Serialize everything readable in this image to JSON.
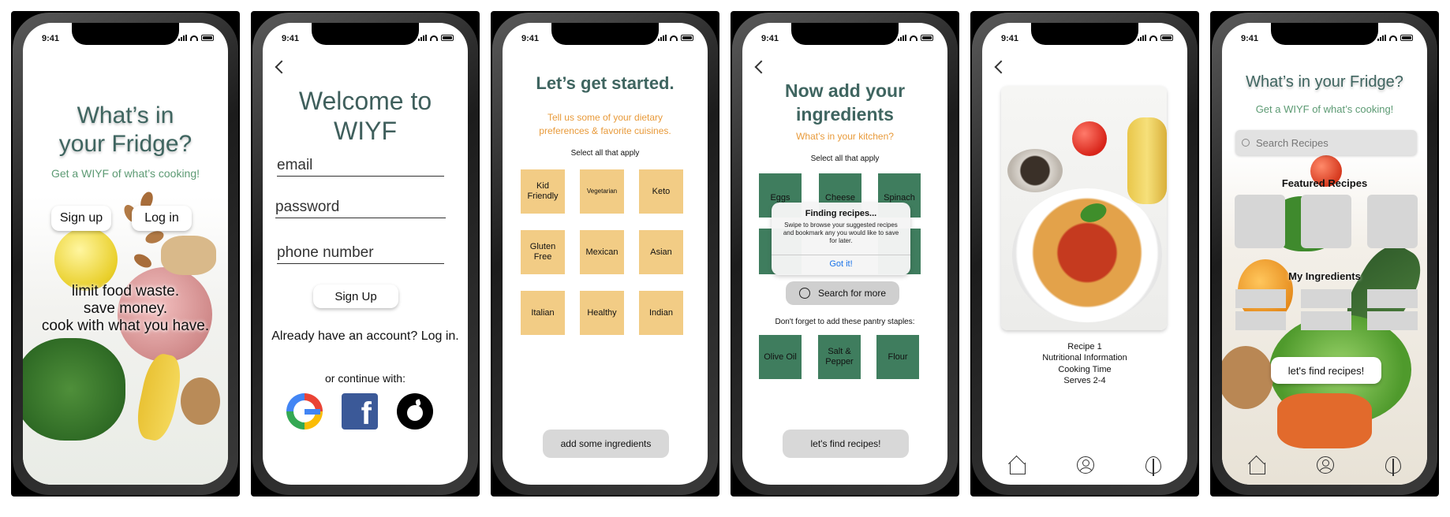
{
  "status_time": "9:41",
  "screens": {
    "landing": {
      "title_line1": "What’s in",
      "title_line2": "your Fridge?",
      "subtitle": "Get a WIYF of what’s cooking!",
      "signup_label": "Sign up",
      "login_label": "Log in",
      "tagline_1": "limit food waste.",
      "tagline_2": "save money.",
      "tagline_3": "cook with what you have."
    },
    "signup": {
      "title_line1": "Welcome to",
      "title_line2": "WIYF",
      "email_placeholder": "email",
      "password_placeholder": "password",
      "phone_placeholder": "phone number",
      "signup_button": "Sign Up",
      "login_prompt": "Already have an account? Log in.",
      "continue_with": "or continue with:",
      "social": [
        "google-icon",
        "facebook-icon",
        "apple-icon"
      ]
    },
    "preferences": {
      "title": "Let’s get started.",
      "subtitle_1": "Tell us some of your dietary",
      "subtitle_2": "preferences & favorite cuisines.",
      "instruction": "Select all that apply",
      "options": [
        "Kid Friendly",
        "Vegetarian",
        "Keto",
        "Gluten Free",
        "Mexican",
        "Asian",
        "Italian",
        "Healthy",
        "Indian"
      ],
      "next_button": "add some ingredients",
      "tile_color": "#f2cc85"
    },
    "ingredients": {
      "title_line1": "Now add your",
      "title_line2": "ingredients",
      "subtitle": "What’s in your kitchen?",
      "instruction": "Select all that apply",
      "options": [
        "Eggs",
        "Cheese",
        "Spinach"
      ],
      "dialog_title": "Finding recipes...",
      "dialog_body": "Swipe to browse your suggested recipes and bookmark any you would like to save for later.",
      "dialog_button": "Got it!",
      "search_label": "Search for more",
      "staples_label": "Don't forget to add these pantry staples:",
      "staples": [
        "Olive Oil",
        "Salt & Pepper",
        "Flour"
      ],
      "find_button": "let's find recipes!",
      "tile_color": "#3f7d5e"
    },
    "recipe": {
      "name": "Recipe 1",
      "nutrition": "Nutritional Information",
      "time": "Cooking Time",
      "serves": "Serves 2-4",
      "tabs": [
        "home-icon",
        "profile-icon",
        "leaf-icon"
      ]
    },
    "home": {
      "title": "What’s in your Fridge?",
      "subtitle": "Get a WIYF of what’s cooking!",
      "search_placeholder": "Search Recipes",
      "featured_heading": "Featured Recipes",
      "my_ingredients_heading": "My Ingredients",
      "find_button": "let's find recipes!",
      "tabs": [
        "home-icon",
        "profile-icon",
        "leaf-icon"
      ]
    }
  }
}
